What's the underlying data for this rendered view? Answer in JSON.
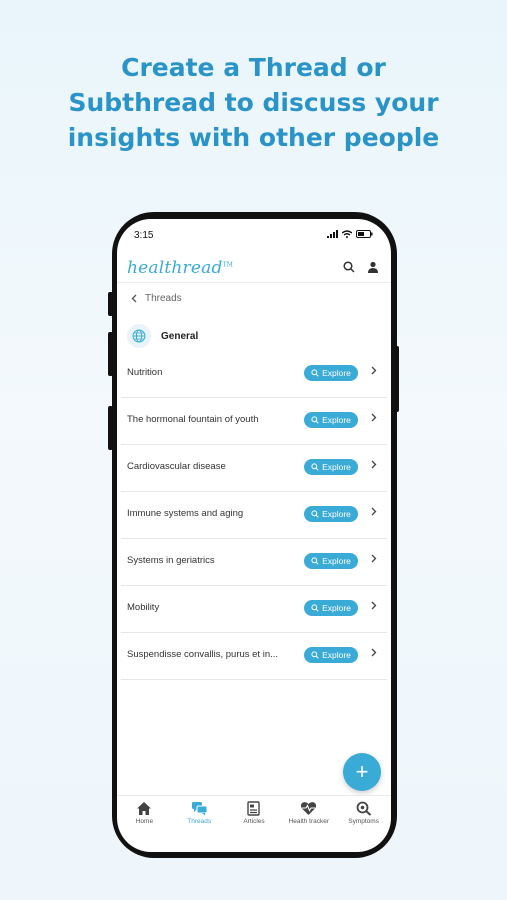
{
  "headline": {
    "line1": "Create a Thread or",
    "line2": "Subthread to discuss your",
    "line3": "insights with other people"
  },
  "status": {
    "time": "3:15"
  },
  "app": {
    "logo": "healthread",
    "tm": "TM"
  },
  "breadcrumb": {
    "label": "Threads"
  },
  "section": {
    "title": "General"
  },
  "explore_label": "Explore",
  "threads": [
    {
      "label": "Nutrition"
    },
    {
      "label": "The hormonal fountain of youth"
    },
    {
      "label": "Cardiovascular disease"
    },
    {
      "label": "Immune systems and aging"
    },
    {
      "label": "Systems in geriatrics"
    },
    {
      "label": "Mobility"
    },
    {
      "label": "Suspendisse convallis, purus et in..."
    }
  ],
  "fab": {
    "label": "+"
  },
  "tabs": [
    {
      "label": "Home",
      "icon": "home-icon",
      "active": false
    },
    {
      "label": "Threads",
      "icon": "threads-icon",
      "active": true
    },
    {
      "label": "Articles",
      "icon": "articles-icon",
      "active": false
    },
    {
      "label": "Health tracker",
      "icon": "health-tracker-icon",
      "active": false
    },
    {
      "label": "Symptoms",
      "icon": "symptoms-icon",
      "active": false
    }
  ],
  "colors": {
    "accent": "#3aaad6",
    "headline": "#2a93c8"
  }
}
